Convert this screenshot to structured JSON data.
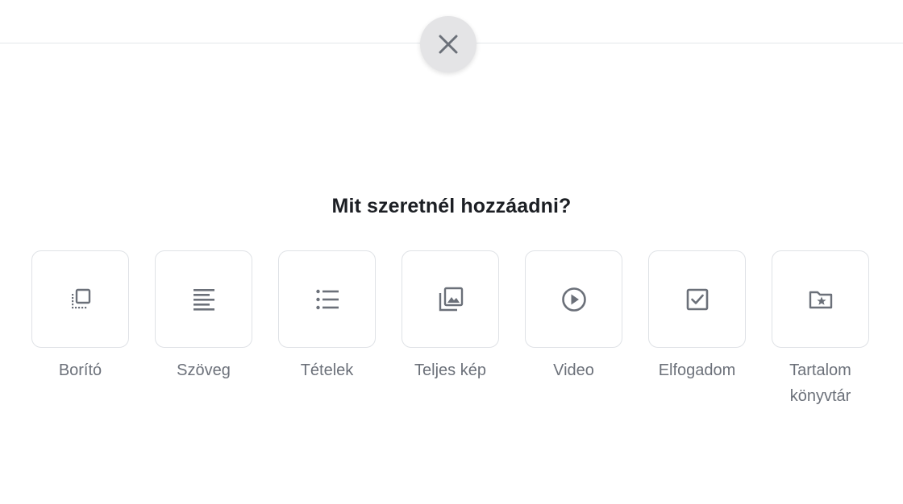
{
  "dialog": {
    "title": "Mit szeretnél hozzáadni?",
    "close_icon": "close-icon"
  },
  "options": [
    {
      "label": "Borító",
      "icon": "cover-icon"
    },
    {
      "label": "Szöveg",
      "icon": "text-align-left-icon"
    },
    {
      "label": "Tételek",
      "icon": "list-icon"
    },
    {
      "label": "Teljes kép",
      "icon": "image-gallery-icon"
    },
    {
      "label": "Video",
      "icon": "play-circle-icon"
    },
    {
      "label": "Elfogadom",
      "icon": "checkbox-icon"
    },
    {
      "label": "Tartalom könyvtár",
      "icon": "folder-star-icon"
    }
  ],
  "colors": {
    "icon": "#6b7079",
    "label": "#6c717a",
    "title": "#1c1f24",
    "tile_border": "#dfe2e6",
    "close_bg": "#e4e4e6"
  }
}
